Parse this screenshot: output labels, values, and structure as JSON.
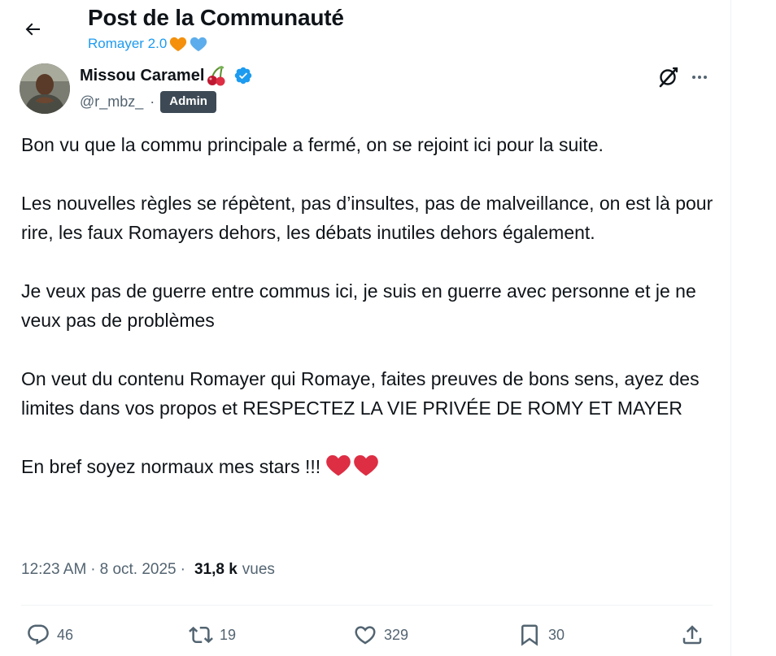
{
  "header": {
    "title": "Post de la Communauté",
    "community": "Romayer 2.0",
    "community_hearts": [
      "orange-heart",
      "blue-heart"
    ]
  },
  "author": {
    "name": "Missou Caramel",
    "name_emoji": "cherries",
    "verified": true,
    "handle": "@r_mbz_",
    "separator": "·",
    "badge": "Admin"
  },
  "post": {
    "paragraphs": [
      "Bon vu que la commu principale a fermé, on se rejoint ici pour la suite.",
      "Les nouvelles règles se répètent, pas d’insultes, pas de malveillance, on est là pour rire, les faux Romayers dehors, les débats inutiles dehors également.",
      "Je veux pas de guerre entre commus ici, je suis en guerre avec personne et je ne veux pas de problèmes",
      "On veut du contenu Romayer qui Romaye, faites preuves de bons sens, ayez des limites dans vos propos et RESPECTEZ LA VIE PRIVÉE DE ROMY ET MAYER",
      "En bref soyez normaux mes stars !!!"
    ],
    "last_paragraph_emojis": [
      "red-heart",
      "red-heart"
    ]
  },
  "meta": {
    "time": "12:23 AM",
    "dot1": "·",
    "date": "8 oct. 2025",
    "dot2": "·",
    "views_count": "31,8 k",
    "views_label": "vues"
  },
  "actions": {
    "replies": "46",
    "reposts": "19",
    "likes": "329",
    "bookmarks": "30"
  },
  "colors": {
    "accent": "#1d9bf0",
    "text": "#0f1419",
    "secondary": "#536471",
    "badge_bg": "#3d4a55",
    "heart_red": "#e0245e"
  }
}
